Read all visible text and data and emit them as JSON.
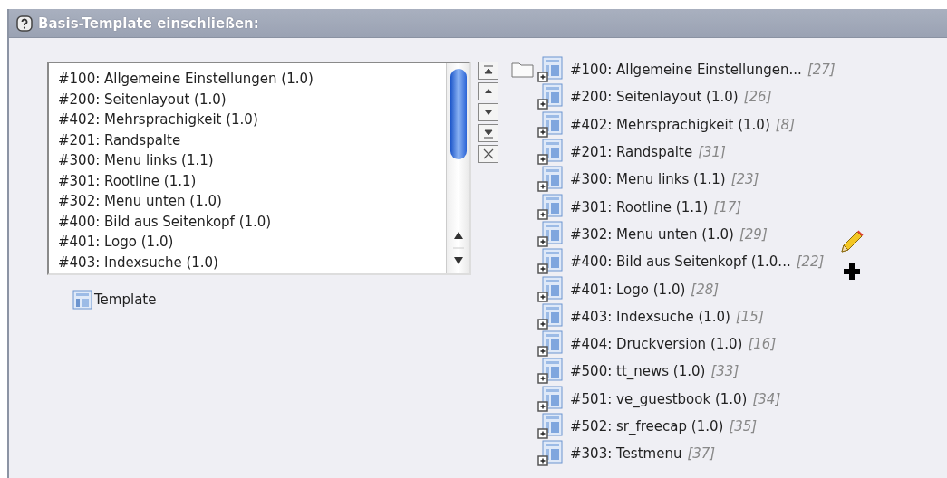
{
  "header": {
    "title": "Basis-Template einschließen:"
  },
  "select_list": {
    "options": [
      "#100: Allgemeine Einstellungen (1.0)",
      "#200: Seitenlayout (1.0)",
      "#402: Mehrsprachigkeit (1.0)",
      "#201: Randspalte",
      "#300: Menu links (1.1)",
      "#301: Rootline (1.1)",
      "#302: Menu unten (1.0)",
      "#400: Bild aus Seitenkopf (1.0)",
      "#401: Logo (1.0)",
      "#403: Indexsuche (1.0)"
    ]
  },
  "template_link": {
    "label": "Template"
  },
  "tree": {
    "items": [
      {
        "label": "#100: Allgemeine Einstellungen...",
        "count": "[27]"
      },
      {
        "label": "#200: Seitenlayout (1.0)",
        "count": "[26]"
      },
      {
        "label": "#402: Mehrsprachigkeit (1.0)",
        "count": "[8]"
      },
      {
        "label": "#201: Randspalte",
        "count": "[31]"
      },
      {
        "label": "#300: Menu links (1.1)",
        "count": "[23]"
      },
      {
        "label": "#301: Rootline (1.1)",
        "count": "[17]"
      },
      {
        "label": "#302: Menu unten (1.0)",
        "count": "[29]"
      },
      {
        "label": "#400: Bild aus Seitenkopf (1.0...",
        "count": "[22]"
      },
      {
        "label": "#401: Logo (1.0)",
        "count": "[28]"
      },
      {
        "label": "#403: Indexsuche (1.0)",
        "count": "[15]"
      },
      {
        "label": "#404: Druckversion (1.0)",
        "count": "[16]"
      },
      {
        "label": "#500: tt_news (1.0)",
        "count": "[33]"
      },
      {
        "label": "#501: ve_guestbook (1.0)",
        "count": "[34]"
      },
      {
        "label": "#502: sr_freecap (1.0)",
        "count": "[35]"
      },
      {
        "label": "#303: Testmenu",
        "count": "[37]"
      }
    ]
  }
}
